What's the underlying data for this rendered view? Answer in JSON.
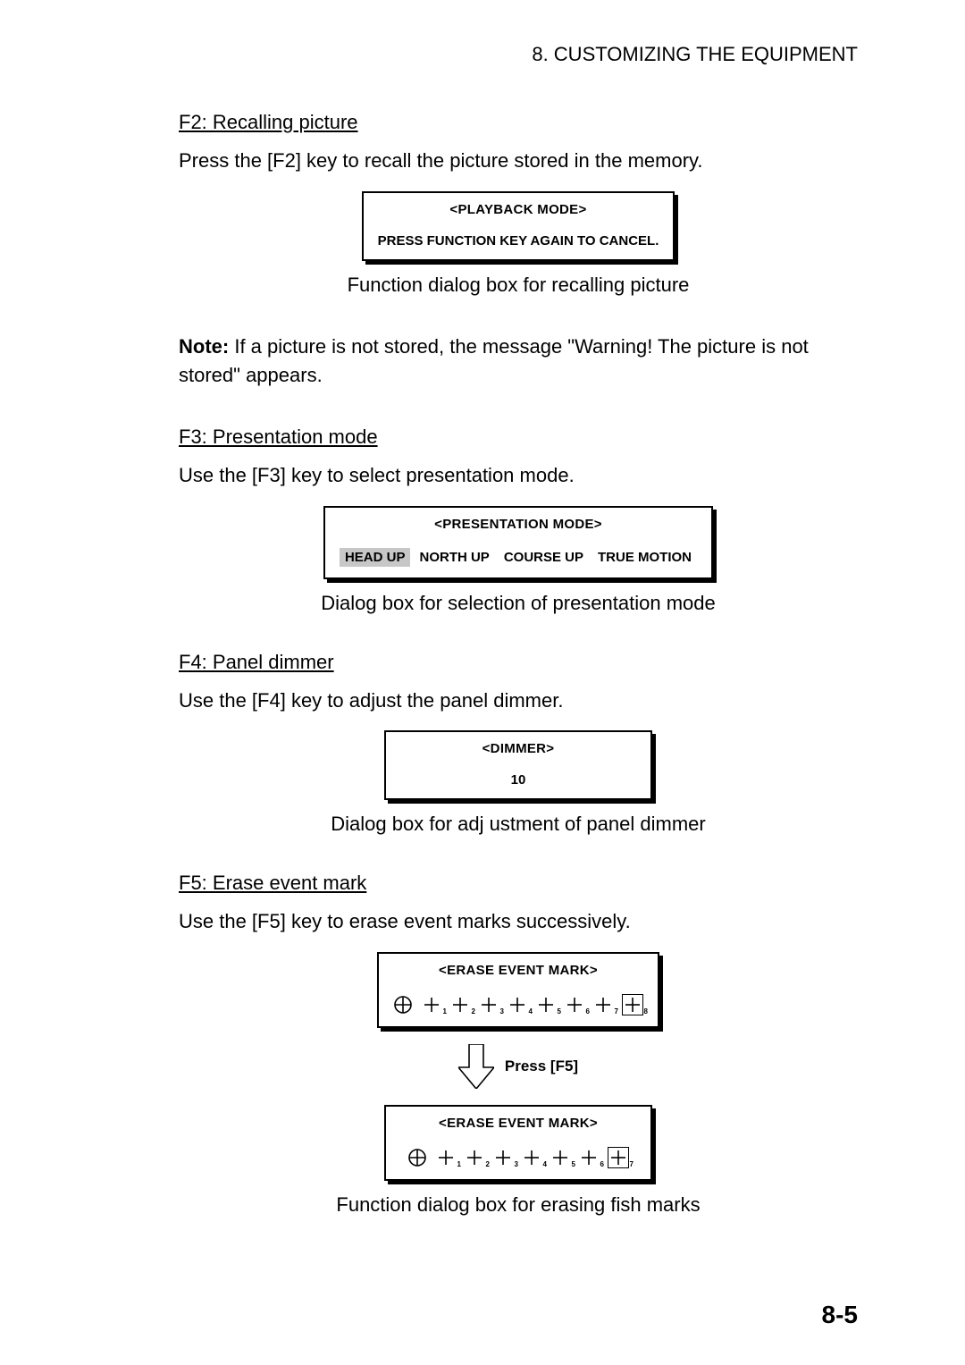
{
  "header": "8. CUSTOMIZING THE EQUIPMENT",
  "f2": {
    "title": "F2: Recalling picture",
    "text": "Press the [F2] key to recall the picture stored in the memory.",
    "dialog_title": "<PLAYBACK MODE>",
    "dialog_body": "PRESS FUNCTION KEY AGAIN TO CANCEL.",
    "caption": "Function dialog box  for recalling picture",
    "note_label": "Note:",
    "note_body": " If a picture is not stored, the message \"Warning! The picture is not stored\" appears."
  },
  "f3": {
    "title": "F3: Presentation mode",
    "text": "Use the [F3] key to select presentation mode.",
    "dialog_title": "<PRESENTATION MODE>",
    "options": [
      "HEAD UP",
      "NORTH UP",
      "COURSE UP",
      "TRUE MOTION"
    ],
    "selected_index": 0,
    "caption": "Dialog box  for selection of presentation mode"
  },
  "f4": {
    "title": "F4: Panel dimmer",
    "text": "Use the [F4] key to adjust the panel dimmer.",
    "dialog_title": "<DIMMER>",
    "value": "10",
    "caption": "Dialog box  for adj ustment of panel dimmer"
  },
  "f5": {
    "title": "F5: Erase event mark",
    "text": "Use the [F5] key to erase event marks successively.",
    "dialog_title_1": "<ERASE EVENT MARK>",
    "dialog_title_2": "<ERASE EVENT MARK>",
    "marks_before": [
      "",
      "1",
      "2",
      "3",
      "4",
      "5",
      "6",
      "7",
      "8"
    ],
    "marks_after": [
      "",
      "1",
      "2",
      "3",
      "4",
      "5",
      "6",
      "7"
    ],
    "arrow_label": "Press [F5]",
    "caption": "Function dialog box  for erasing fish marks"
  },
  "page_number": "8-5"
}
